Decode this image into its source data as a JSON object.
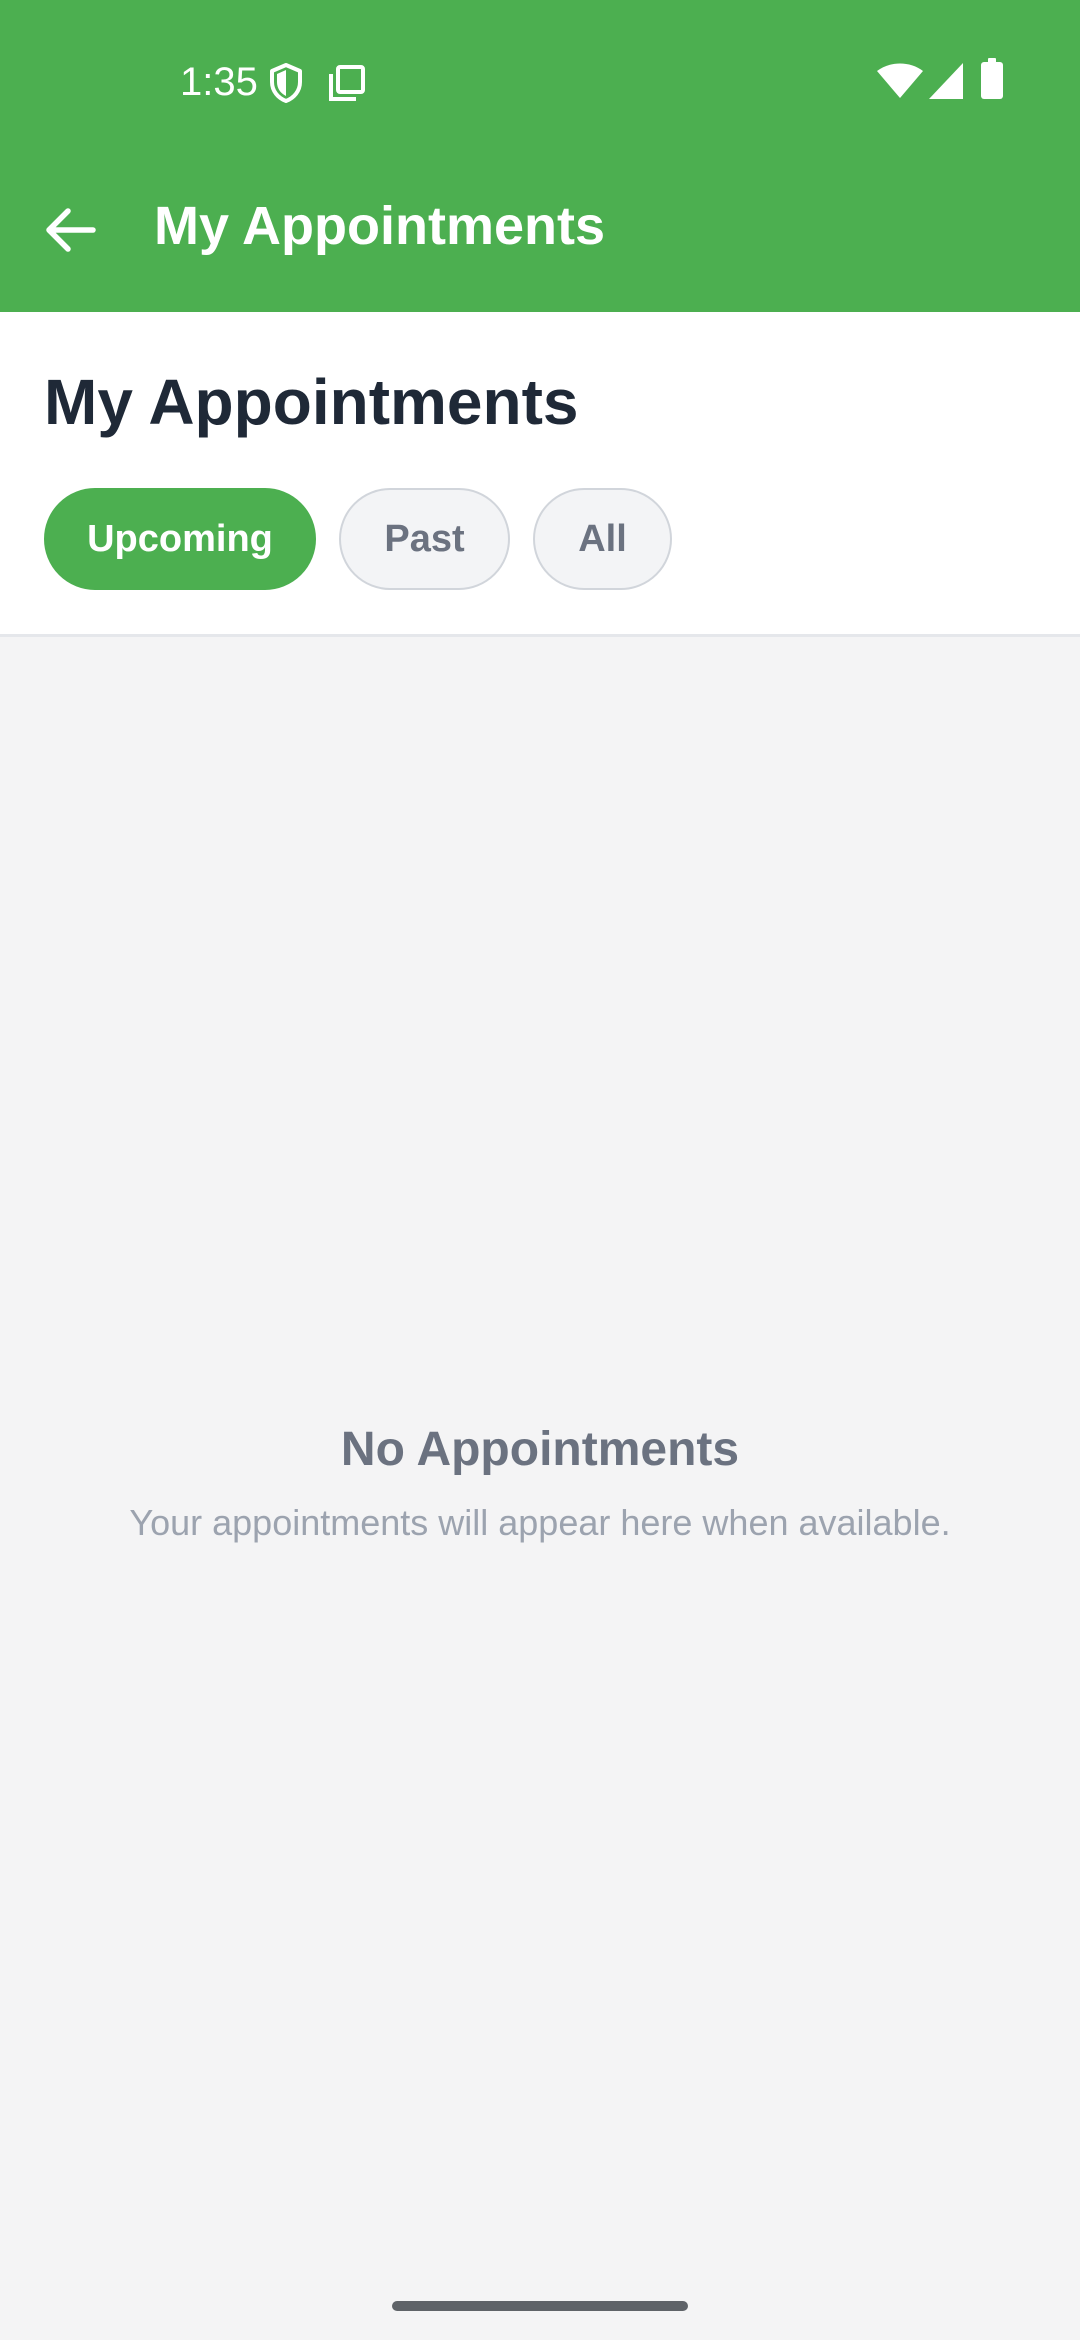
{
  "status_bar": {
    "time": "1:35",
    "icons": [
      "shield-icon",
      "copy-icon",
      "wifi-icon",
      "cellular-signal-icon",
      "battery-icon"
    ]
  },
  "toolbar": {
    "back_icon": "arrow-left-icon",
    "title": "My Appointments"
  },
  "header": {
    "title": "My Appointments",
    "filters": [
      {
        "label": "Upcoming",
        "active": true
      },
      {
        "label": "Past",
        "active": false
      },
      {
        "label": "All",
        "active": false
      }
    ]
  },
  "empty_state": {
    "title": "No Appointments",
    "message": "Your appointments will appear here when available."
  },
  "colors": {
    "primary": "#4caf50",
    "title_text": "#1f2937",
    "muted_text": "#6b7280",
    "subtle_text": "#9ca3af",
    "background": "#f4f4f5"
  }
}
